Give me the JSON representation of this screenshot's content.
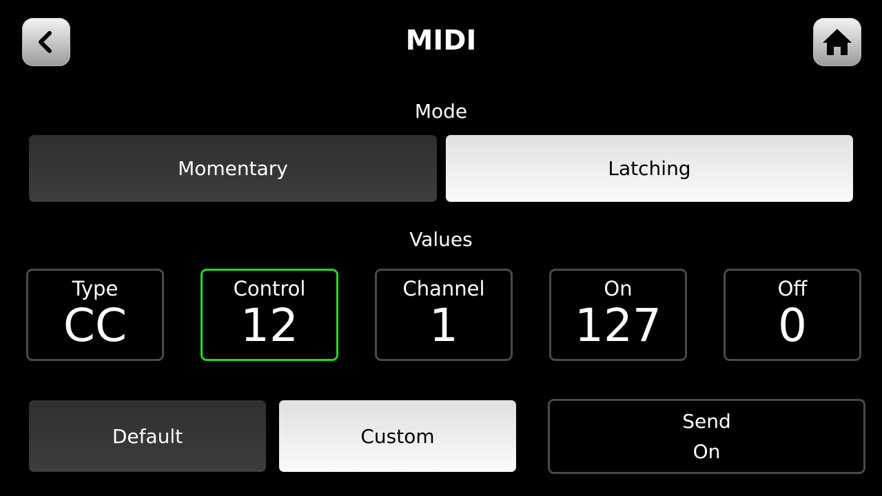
{
  "header": {
    "title": "MIDI",
    "back_icon": "chevron-left-icon",
    "home_icon": "home-icon"
  },
  "mode": {
    "label": "Mode",
    "options": [
      {
        "label": "Momentary",
        "selected": false
      },
      {
        "label": "Latching",
        "selected": true
      }
    ]
  },
  "values": {
    "label": "Values",
    "fields": [
      {
        "label": "Type",
        "value": "CC",
        "selected": false
      },
      {
        "label": "Control",
        "value": "12",
        "selected": true
      },
      {
        "label": "Channel",
        "value": "1",
        "selected": false
      },
      {
        "label": "On",
        "value": "127",
        "selected": false
      },
      {
        "label": "Off",
        "value": "0",
        "selected": false
      }
    ],
    "selected_color": "#22dd22"
  },
  "preset": {
    "options": [
      {
        "label": "Default",
        "selected": false
      },
      {
        "label": "Custom",
        "selected": true
      }
    ]
  },
  "send": {
    "line1": "Send",
    "line2": "On"
  }
}
